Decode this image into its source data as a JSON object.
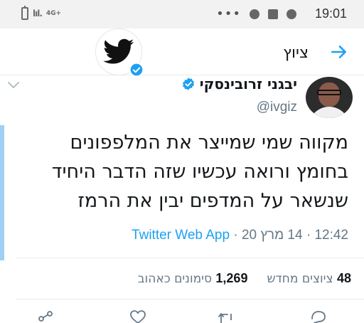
{
  "status_bar": {
    "network": "4G+",
    "overflow": "•••",
    "time": "19:01",
    "icons": [
      "battery-icon",
      "signal-icon",
      "chrome-icon",
      "image-icon",
      "chrome-icon"
    ]
  },
  "header": {
    "title": "ציוץ",
    "back_icon": "arrow-right-icon",
    "brand_icon": "twitter-bird-icon",
    "brand_badge_icon": "verified-badge-icon"
  },
  "tweet": {
    "display_name": "יבגני זרובינסקי",
    "handle": "@ivgiz",
    "verified": true,
    "text_lines": [
      "מקווה שמי שמייצר את המלפפונים",
      "בחומץ ורואה עכשיו שזה הדבר היחיד",
      "שנשאר על המדפים יבין את הרמז"
    ],
    "time": "12:42",
    "sep1": "·",
    "date": "14 מרץ 20",
    "sep2": "·",
    "source": "Twitter Web App",
    "retweets_count": "48",
    "retweets_label": "ציוצים מחדש",
    "likes_count": "1,269",
    "likes_label": "סימונים כאהוב"
  },
  "colors": {
    "accent": "#1da1f2",
    "muted": "#657786",
    "text": "#14171a",
    "left_accent": "#9ed0f5"
  },
  "actions": [
    "reply-icon",
    "retweet-icon",
    "like-icon",
    "share-icon"
  ]
}
